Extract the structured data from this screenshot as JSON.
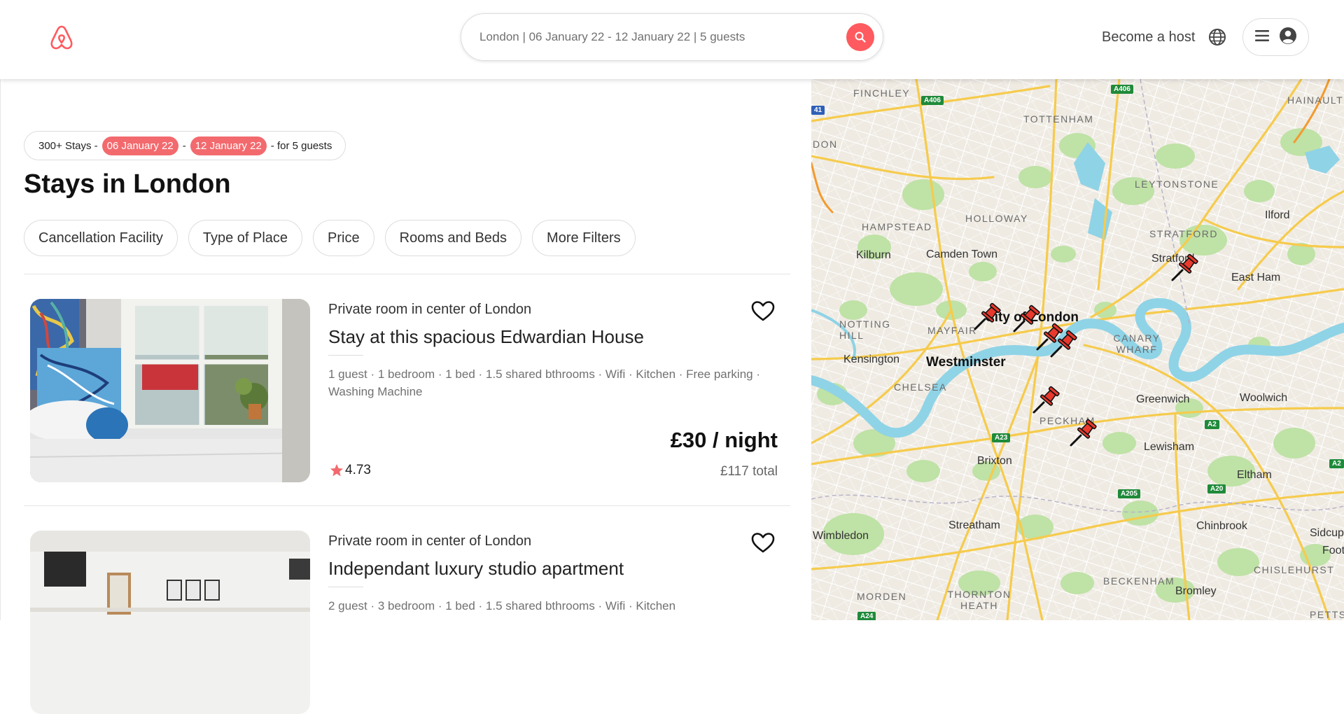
{
  "header": {
    "logo": "airbnb-logo-icon",
    "search_text": "London | 06 January 22 - 12 January 22 | 5 guests",
    "become_host": "Become a host",
    "accent_color": "#FF5A5F"
  },
  "summary": {
    "prefix": "300+ Stays -",
    "start_date": "06 January 22",
    "separator": "-",
    "end_date": "12 January 22",
    "suffix": "- for 5 guests"
  },
  "page_title": "Stays in London",
  "filters": [
    "Cancellation Facility",
    "Type of Place",
    "Price",
    "Rooms and Beds",
    "More Filters"
  ],
  "listings": [
    {
      "subtitle": "Private room in center of London",
      "title": "Stay at this spacious Edwardian House",
      "amenities": "1 guest · 1 bedroom · 1 bed · 1.5 shared bthrooms · Wifi · Kitchen · Free parking · Washing Machine",
      "price": "£30 / night",
      "total": "£117 total",
      "rating": "4.73"
    },
    {
      "subtitle": "Private room in center of London",
      "title": "Independant luxury studio apartment",
      "amenities": "2 guest · 3 bedroom · 1 bed · 1.5 shared bthrooms · Wifi · Kitchen"
    }
  ],
  "map": {
    "places_caps": [
      "FINCHLEY",
      "TOTTENHAM",
      "HAINAULT",
      "LEYTONSTONE",
      "HAMPSTEAD",
      "HOLLOWAY",
      "STRATFORD",
      "NOTTING HILL",
      "MAYFAIR",
      "CANARY WHARF",
      "CHELSEA",
      "PECKHAM",
      "CHISLEHURST",
      "BECKENHAM",
      "THORNTON HEATH",
      "MORDEN",
      "PETTS",
      "DON"
    ],
    "places_towns": [
      "Ilford",
      "Kilburn",
      "Camden Town",
      "Stratford",
      "East Ham",
      "Kensington",
      "Greenwich",
      "Woolwich",
      "Lewisham",
      "Brixton",
      "Eltham",
      "Streatham",
      "Chinbrook",
      "Wimbledon",
      "Sidcup",
      "Bromley",
      "Foot"
    ],
    "places_big": [
      "City of London",
      "Westminster"
    ],
    "roads": [
      "A406",
      "A406",
      "A23",
      "A2",
      "A2",
      "A205",
      "A20",
      "A24",
      "41"
    ]
  }
}
